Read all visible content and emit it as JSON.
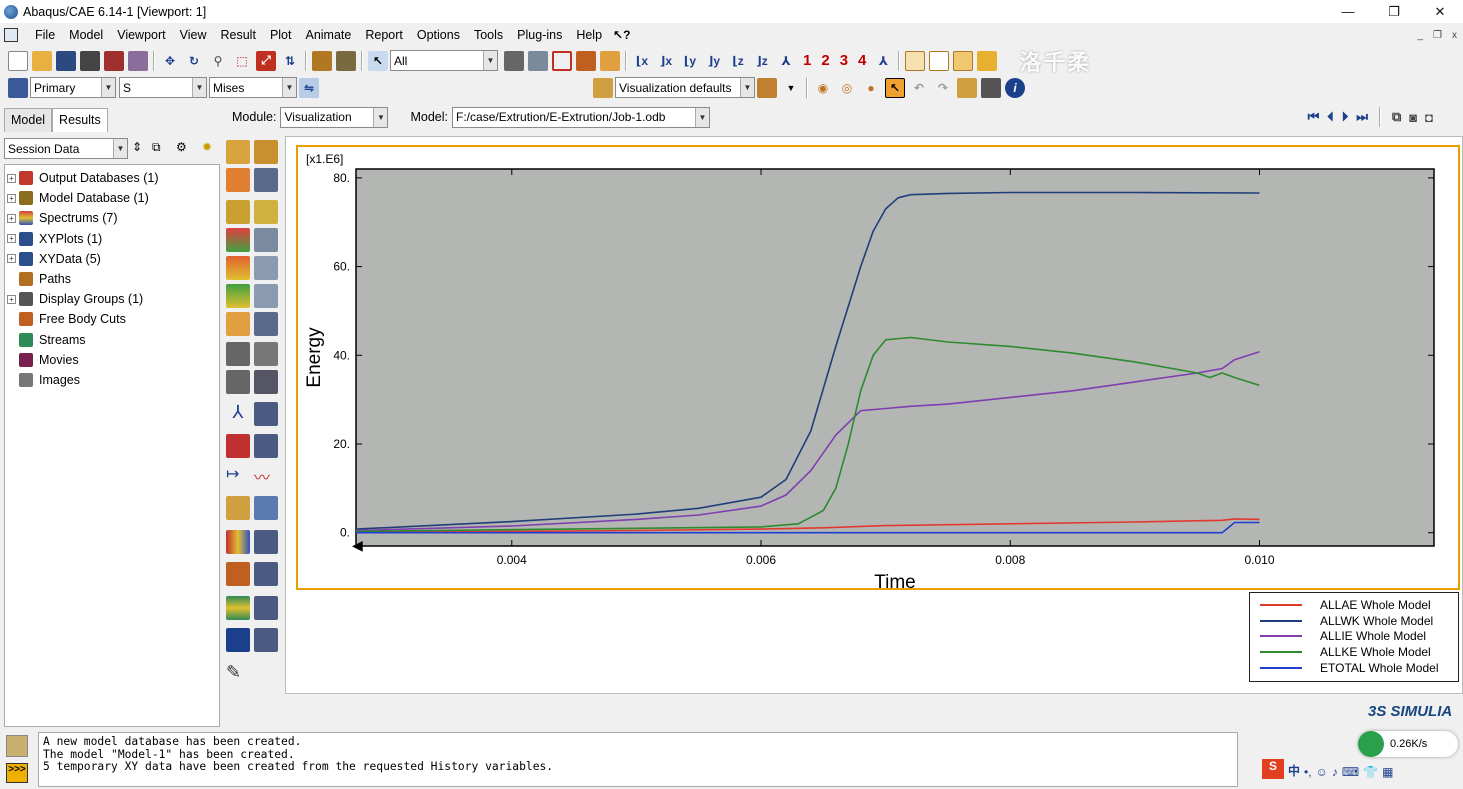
{
  "window": {
    "title": "Abaqus/CAE 6.14-1 [Viewport: 1]",
    "controls": [
      "—",
      "❐",
      "✕"
    ]
  },
  "menu": {
    "items": [
      "File",
      "Model",
      "Viewport",
      "View",
      "Result",
      "Plot",
      "Animate",
      "Report",
      "Options",
      "Tools",
      "Plug-ins",
      "Help"
    ],
    "whats_this": "↖?",
    "mdi_controls": [
      "_",
      "❐",
      "x"
    ]
  },
  "toolbar1": {
    "selection_filter": "All",
    "view_numbers": [
      "1",
      "2",
      "3",
      "4"
    ],
    "watermark": "洛千柔"
  },
  "toolbar2": {
    "step_frame": "Primary",
    "field_variable": "S",
    "invariant": "Mises",
    "visualization_defaults": "Visualization defaults"
  },
  "left_panel": {
    "tabs": [
      "Model",
      "Results"
    ],
    "active_tab": "Results",
    "session_combo": "Session Data",
    "tree": [
      {
        "label": "Output Databases (1)",
        "expandable": true,
        "icon_color": "#c0392b"
      },
      {
        "label": "Model Database (1)",
        "expandable": true,
        "icon_color": "#8a6d1f"
      },
      {
        "label": "Spectrums (7)",
        "expandable": true,
        "icon_color": "#d04040"
      },
      {
        "label": "XYPlots (1)",
        "expandable": true,
        "icon_color": "#2a4f8a"
      },
      {
        "label": "XYData (5)",
        "expandable": true,
        "icon_color": "#2a4f8a"
      },
      {
        "label": "Paths",
        "expandable": false,
        "icon_color": "#b07020"
      },
      {
        "label": "Display Groups (1)",
        "expandable": true,
        "icon_color": "#555555"
      },
      {
        "label": "Free Body Cuts",
        "expandable": false,
        "icon_color": "#c06020"
      },
      {
        "label": "Streams",
        "expandable": false,
        "icon_color": "#2e8b57"
      },
      {
        "label": "Movies",
        "expandable": false,
        "icon_color": "#7a2050"
      },
      {
        "label": "Images",
        "expandable": false,
        "icon_color": "#777777"
      }
    ]
  },
  "module_bar": {
    "module_label": "Module:",
    "module_value": "Visualization",
    "model_label": "Model:",
    "model_value": "F:/case/Extrution/E-Extrution/Job-1.odb"
  },
  "chart_data": {
    "type": "line",
    "xlabel": "Time",
    "ylabel": "Energy",
    "y_multiplier": "[x1.E6]",
    "xlim": [
      0.00275,
      0.0114
    ],
    "ylim": [
      -3,
      82
    ],
    "x_ticks": [
      "0.004",
      "0.006",
      "0.008",
      "0.010"
    ],
    "x_tick_values": [
      0.004,
      0.006,
      0.008,
      0.01
    ],
    "y_ticks": [
      "0.",
      "20.",
      "40.",
      "60.",
      "80."
    ],
    "y_tick_values": [
      0,
      20,
      40,
      60,
      80
    ],
    "plot_background": "#b4b6b3",
    "series": [
      {
        "name": "ALLAE Whole Model",
        "color": "#e03a2f",
        "x": [
          0.00275,
          0.004,
          0.005,
          0.006,
          0.0065,
          0.007,
          0.008,
          0.009,
          0.0097,
          0.0098,
          0.01
        ],
        "y": [
          0.1,
          0.3,
          0.5,
          0.8,
          1.1,
          1.6,
          2.0,
          2.4,
          2.8,
          3.1,
          3.0
        ]
      },
      {
        "name": "ALLWK Whole Model",
        "color": "#1f3f7a",
        "x": [
          0.00275,
          0.004,
          0.005,
          0.0055,
          0.006,
          0.0062,
          0.0064,
          0.0066,
          0.0068,
          0.0069,
          0.007,
          0.0071,
          0.0072,
          0.0075,
          0.008,
          0.009,
          0.01
        ],
        "y": [
          0.8,
          2.5,
          4.2,
          5.5,
          8.0,
          12.0,
          23.0,
          42.0,
          60.0,
          68.0,
          73.0,
          75.5,
          76.2,
          76.5,
          76.7,
          76.7,
          76.6
        ]
      },
      {
        "name": "ALLIE Whole Model",
        "color": "#7f3fb0",
        "x": [
          0.00275,
          0.004,
          0.005,
          0.0055,
          0.006,
          0.0062,
          0.0064,
          0.0066,
          0.0068,
          0.007,
          0.0072,
          0.0075,
          0.008,
          0.0085,
          0.009,
          0.0095,
          0.0097,
          0.0098,
          0.01
        ],
        "y": [
          0.5,
          1.5,
          3.0,
          4.0,
          6.0,
          8.5,
          14.0,
          22.0,
          27.5,
          28.0,
          28.5,
          29.0,
          30.5,
          32.0,
          34.0,
          36.0,
          37.0,
          39.0,
          40.8
        ]
      },
      {
        "name": "ALLKE Whole Model",
        "color": "#2e8a2e",
        "x": [
          0.00275,
          0.005,
          0.006,
          0.0063,
          0.0065,
          0.0066,
          0.0067,
          0.0068,
          0.0069,
          0.007,
          0.0072,
          0.0075,
          0.008,
          0.0085,
          0.009,
          0.0095,
          0.0096,
          0.0097,
          0.0098,
          0.01
        ],
        "y": [
          0.3,
          1.0,
          1.3,
          2.0,
          5.0,
          10.0,
          20.0,
          32.0,
          40.0,
          43.5,
          44.0,
          43.0,
          42.0,
          40.5,
          38.5,
          36.0,
          35.0,
          36.0,
          35.0,
          33.2
        ]
      },
      {
        "name": "ETOTAL Whole Model",
        "color": "#1f3fd0",
        "x": [
          0.00275,
          0.004,
          0.005,
          0.006,
          0.007,
          0.008,
          0.009,
          0.0096,
          0.0097,
          0.0098,
          0.01
        ],
        "y": [
          0.0,
          0.0,
          0.0,
          0.0,
          0.0,
          0.0,
          0.0,
          0.0,
          0.0,
          2.3,
          2.3
        ]
      }
    ]
  },
  "footer": {
    "brand": "SIMULIA",
    "messages": [
      "A new model database has been created.",
      "The model \"Model-1\" has been created.",
      "5 temporary XY data have been created from the requested History variables."
    ],
    "net_speed": "0.26K/s",
    "ime_label": "中"
  }
}
